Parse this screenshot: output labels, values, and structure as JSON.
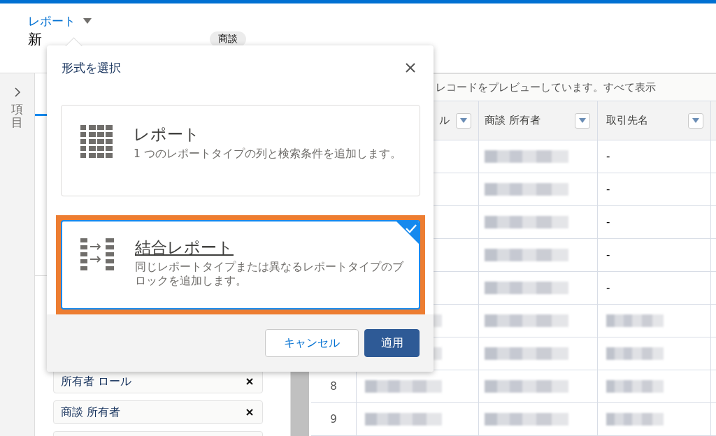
{
  "app_menu": {
    "label": "レポート"
  },
  "page_title": "新",
  "object_tag": "商談",
  "side_rail": {
    "label": "項目",
    "collapsed": true
  },
  "fields": [
    {
      "label": "所有者 ロール"
    },
    {
      "label": "商談 所有者"
    }
  ],
  "preview_notice": "レコードをプレビューしています。すべて表示",
  "table": {
    "columns": [
      {
        "label": "ル"
      },
      {
        "label": "商談 所有者"
      },
      {
        "label": "取引先名"
      }
    ],
    "rows": [
      {
        "cells": [
          {
            "kind": "hidden"
          },
          {
            "kind": "blurred"
          },
          {
            "kind": "text",
            "text": "-"
          }
        ]
      },
      {
        "cells": [
          {
            "kind": "hidden"
          },
          {
            "kind": "blurred"
          },
          {
            "kind": "text",
            "text": "-"
          }
        ]
      },
      {
        "cells": [
          {
            "kind": "hidden"
          },
          {
            "kind": "blurred"
          },
          {
            "kind": "text",
            "text": "-"
          }
        ]
      },
      {
        "cells": [
          {
            "kind": "hidden"
          },
          {
            "kind": "blurred"
          },
          {
            "kind": "text",
            "text": "-"
          }
        ]
      },
      {
        "cells": [
          {
            "kind": "hidden"
          },
          {
            "kind": "blurred"
          },
          {
            "kind": "text",
            "text": "-"
          }
        ]
      },
      {
        "cells": [
          {
            "kind": "blurred"
          },
          {
            "kind": "blurred"
          },
          {
            "kind": "blurred"
          }
        ]
      },
      {
        "cells": [
          {
            "kind": "blurred"
          },
          {
            "kind": "blurred"
          },
          {
            "kind": "blurred"
          }
        ]
      },
      {
        "number": "8",
        "cells": [
          {
            "kind": "blurred"
          },
          {
            "kind": "blurred"
          },
          {
            "kind": "blurred"
          }
        ]
      },
      {
        "number": "9",
        "cells": [
          {
            "kind": "blurred"
          },
          {
            "kind": "blurred"
          },
          {
            "kind": "blurred"
          }
        ]
      }
    ]
  },
  "dialog": {
    "title": "形式を選択",
    "options": [
      {
        "kind": "single",
        "title": "レポート",
        "description": "1 つのレポートタイプの列と検索条件を追加します。",
        "selected": false,
        "focused": false,
        "highlighted": false
      },
      {
        "kind": "joined",
        "title": "結合レポート",
        "description": "同じレポートタイプまたは異なるレポートタイプのブロックを追加します。",
        "selected": true,
        "focused": true,
        "highlighted": true
      }
    ],
    "buttons": [
      {
        "label": "キャンセル",
        "kind": "neutral"
      },
      {
        "label": "適用",
        "kind": "brand"
      }
    ]
  }
}
